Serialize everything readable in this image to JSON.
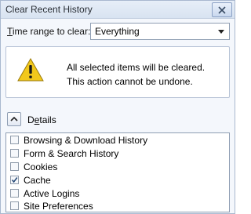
{
  "window": {
    "title": "Clear Recent History"
  },
  "time_range": {
    "label_mnemonic": "T",
    "label_rest": "ime range to clear:",
    "selected": "Everything"
  },
  "warning": {
    "line1": "All selected items will be cleared.",
    "line2": "This action cannot be undone."
  },
  "details": {
    "label_start": "D",
    "label_mnemonic": "e",
    "label_rest": "tails",
    "expanded": true
  },
  "items": [
    {
      "label": "Browsing & Download History",
      "checked": false
    },
    {
      "label": "Form & Search History",
      "checked": false
    },
    {
      "label": "Cookies",
      "checked": false
    },
    {
      "label": "Cache",
      "checked": true
    },
    {
      "label": "Active Logins",
      "checked": false
    },
    {
      "label": "Site Preferences",
      "checked": false
    }
  ],
  "colors": {
    "titlebar": "#dfe8f5",
    "warning_icon": "#f2c81c",
    "checkmark": "#2a4d7a"
  }
}
